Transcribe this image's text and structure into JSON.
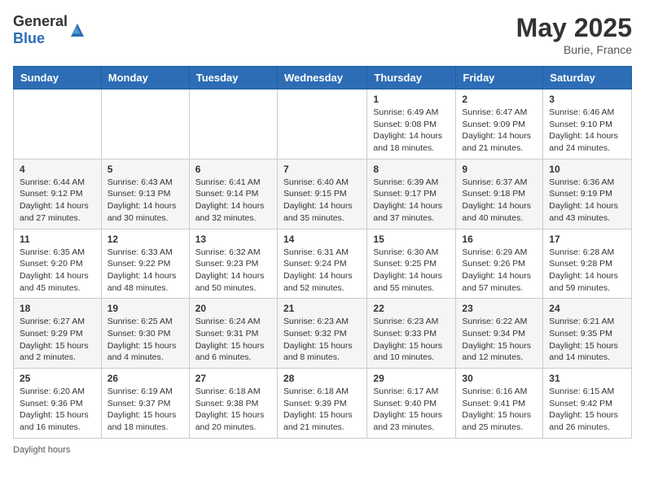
{
  "header": {
    "logo_general": "General",
    "logo_blue": "Blue",
    "month": "May 2025",
    "location": "Burie, France"
  },
  "days_of_week": [
    "Sunday",
    "Monday",
    "Tuesday",
    "Wednesday",
    "Thursday",
    "Friday",
    "Saturday"
  ],
  "weeks": [
    [
      {
        "day": "",
        "info": ""
      },
      {
        "day": "",
        "info": ""
      },
      {
        "day": "",
        "info": ""
      },
      {
        "day": "",
        "info": ""
      },
      {
        "day": "1",
        "info": "Sunrise: 6:49 AM\nSunset: 9:08 PM\nDaylight: 14 hours and 18 minutes."
      },
      {
        "day": "2",
        "info": "Sunrise: 6:47 AM\nSunset: 9:09 PM\nDaylight: 14 hours and 21 minutes."
      },
      {
        "day": "3",
        "info": "Sunrise: 6:46 AM\nSunset: 9:10 PM\nDaylight: 14 hours and 24 minutes."
      }
    ],
    [
      {
        "day": "4",
        "info": "Sunrise: 6:44 AM\nSunset: 9:12 PM\nDaylight: 14 hours and 27 minutes."
      },
      {
        "day": "5",
        "info": "Sunrise: 6:43 AM\nSunset: 9:13 PM\nDaylight: 14 hours and 30 minutes."
      },
      {
        "day": "6",
        "info": "Sunrise: 6:41 AM\nSunset: 9:14 PM\nDaylight: 14 hours and 32 minutes."
      },
      {
        "day": "7",
        "info": "Sunrise: 6:40 AM\nSunset: 9:15 PM\nDaylight: 14 hours and 35 minutes."
      },
      {
        "day": "8",
        "info": "Sunrise: 6:39 AM\nSunset: 9:17 PM\nDaylight: 14 hours and 37 minutes."
      },
      {
        "day": "9",
        "info": "Sunrise: 6:37 AM\nSunset: 9:18 PM\nDaylight: 14 hours and 40 minutes."
      },
      {
        "day": "10",
        "info": "Sunrise: 6:36 AM\nSunset: 9:19 PM\nDaylight: 14 hours and 43 minutes."
      }
    ],
    [
      {
        "day": "11",
        "info": "Sunrise: 6:35 AM\nSunset: 9:20 PM\nDaylight: 14 hours and 45 minutes."
      },
      {
        "day": "12",
        "info": "Sunrise: 6:33 AM\nSunset: 9:22 PM\nDaylight: 14 hours and 48 minutes."
      },
      {
        "day": "13",
        "info": "Sunrise: 6:32 AM\nSunset: 9:23 PM\nDaylight: 14 hours and 50 minutes."
      },
      {
        "day": "14",
        "info": "Sunrise: 6:31 AM\nSunset: 9:24 PM\nDaylight: 14 hours and 52 minutes."
      },
      {
        "day": "15",
        "info": "Sunrise: 6:30 AM\nSunset: 9:25 PM\nDaylight: 14 hours and 55 minutes."
      },
      {
        "day": "16",
        "info": "Sunrise: 6:29 AM\nSunset: 9:26 PM\nDaylight: 14 hours and 57 minutes."
      },
      {
        "day": "17",
        "info": "Sunrise: 6:28 AM\nSunset: 9:28 PM\nDaylight: 14 hours and 59 minutes."
      }
    ],
    [
      {
        "day": "18",
        "info": "Sunrise: 6:27 AM\nSunset: 9:29 PM\nDaylight: 15 hours and 2 minutes."
      },
      {
        "day": "19",
        "info": "Sunrise: 6:25 AM\nSunset: 9:30 PM\nDaylight: 15 hours and 4 minutes."
      },
      {
        "day": "20",
        "info": "Sunrise: 6:24 AM\nSunset: 9:31 PM\nDaylight: 15 hours and 6 minutes."
      },
      {
        "day": "21",
        "info": "Sunrise: 6:23 AM\nSunset: 9:32 PM\nDaylight: 15 hours and 8 minutes."
      },
      {
        "day": "22",
        "info": "Sunrise: 6:23 AM\nSunset: 9:33 PM\nDaylight: 15 hours and 10 minutes."
      },
      {
        "day": "23",
        "info": "Sunrise: 6:22 AM\nSunset: 9:34 PM\nDaylight: 15 hours and 12 minutes."
      },
      {
        "day": "24",
        "info": "Sunrise: 6:21 AM\nSunset: 9:35 PM\nDaylight: 15 hours and 14 minutes."
      }
    ],
    [
      {
        "day": "25",
        "info": "Sunrise: 6:20 AM\nSunset: 9:36 PM\nDaylight: 15 hours and 16 minutes."
      },
      {
        "day": "26",
        "info": "Sunrise: 6:19 AM\nSunset: 9:37 PM\nDaylight: 15 hours and 18 minutes."
      },
      {
        "day": "27",
        "info": "Sunrise: 6:18 AM\nSunset: 9:38 PM\nDaylight: 15 hours and 20 minutes."
      },
      {
        "day": "28",
        "info": "Sunrise: 6:18 AM\nSunset: 9:39 PM\nDaylight: 15 hours and 21 minutes."
      },
      {
        "day": "29",
        "info": "Sunrise: 6:17 AM\nSunset: 9:40 PM\nDaylight: 15 hours and 23 minutes."
      },
      {
        "day": "30",
        "info": "Sunrise: 6:16 AM\nSunset: 9:41 PM\nDaylight: 15 hours and 25 minutes."
      },
      {
        "day": "31",
        "info": "Sunrise: 6:15 AM\nSunset: 9:42 PM\nDaylight: 15 hours and 26 minutes."
      }
    ]
  ],
  "footer": {
    "daylight_label": "Daylight hours"
  }
}
